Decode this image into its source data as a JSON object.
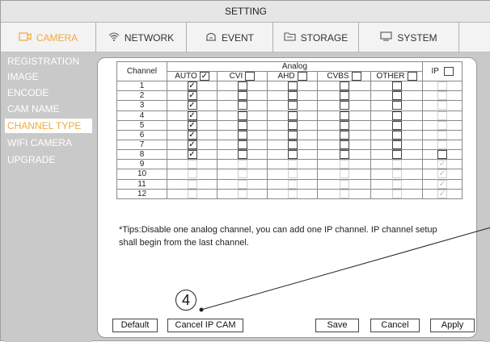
{
  "title": "SETTING",
  "tabs": [
    {
      "label": "CAMERA",
      "icon": "camera-icon",
      "active": true
    },
    {
      "label": "NETWORK",
      "icon": "wifi-icon",
      "active": false
    },
    {
      "label": "EVENT",
      "icon": "event-icon",
      "active": false
    },
    {
      "label": "STORAGE",
      "icon": "storage-icon",
      "active": false
    },
    {
      "label": "SYSTEM",
      "icon": "monitor-icon",
      "active": false
    }
  ],
  "sidebar": [
    {
      "label": "REGISTRATION",
      "active": false
    },
    {
      "label": "IMAGE",
      "active": false
    },
    {
      "label": "ENCODE",
      "active": false
    },
    {
      "label": "CAM NAME",
      "active": false
    },
    {
      "label": "CHANNEL TYPE",
      "active": true
    },
    {
      "label": "WIFI CAMERA",
      "active": false
    },
    {
      "label": "UPGRADE",
      "active": false
    }
  ],
  "grid": {
    "channel_header": "Channel",
    "analog_header": "Analog",
    "ip_header": "IP",
    "columns": [
      {
        "label": "AUTO",
        "checked": true
      },
      {
        "label": "CVI",
        "checked": false
      },
      {
        "label": "AHD",
        "checked": false
      },
      {
        "label": "CVBS",
        "checked": false
      },
      {
        "label": "OTHER",
        "checked": false
      }
    ],
    "rows": [
      {
        "channel": "1",
        "auto": true,
        "analog_enabled": true,
        "ip": "disabled"
      },
      {
        "channel": "2",
        "auto": true,
        "analog_enabled": true,
        "ip": "disabled"
      },
      {
        "channel": "3",
        "auto": true,
        "analog_enabled": true,
        "ip": "disabled"
      },
      {
        "channel": "4",
        "auto": true,
        "analog_enabled": true,
        "ip": "disabled"
      },
      {
        "channel": "5",
        "auto": true,
        "analog_enabled": true,
        "ip": "disabled"
      },
      {
        "channel": "6",
        "auto": true,
        "analog_enabled": true,
        "ip": "disabled"
      },
      {
        "channel": "7",
        "auto": true,
        "analog_enabled": true,
        "ip": "disabled"
      },
      {
        "channel": "8",
        "auto": true,
        "analog_enabled": true,
        "ip": "unchecked"
      },
      {
        "channel": "9",
        "auto": false,
        "analog_enabled": false,
        "ip": "checked-dim"
      },
      {
        "channel": "10",
        "auto": false,
        "analog_enabled": false,
        "ip": "checked-dim"
      },
      {
        "channel": "11",
        "auto": false,
        "analog_enabled": false,
        "ip": "checked-dim"
      },
      {
        "channel": "12",
        "auto": false,
        "analog_enabled": false,
        "ip": "checked-dim"
      }
    ]
  },
  "tips": "*Tips:Disable one analog channel, you can add one IP channel. IP channel setup shall begin from the last channel.",
  "buttons": {
    "default": "Default",
    "cancel_ip_cam": "Cancel IP CAM",
    "save": "Save",
    "cancel": "Cancel",
    "apply": "Apply"
  },
  "callout": "4",
  "colors": {
    "accent": "#f2a93b",
    "sidebar_bg": "#c9c9c9"
  }
}
